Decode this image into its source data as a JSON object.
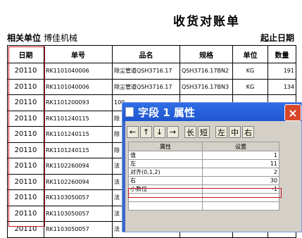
{
  "report": {
    "title": "收货对账单",
    "unit_label": "相关单位",
    "unit_value": "博佳机械",
    "date_label": "起止日期",
    "columns": [
      "日期",
      "单号",
      "品名",
      "规格",
      "单位",
      "数量"
    ],
    "rows": [
      {
        "date": "20110",
        "no": "RK1101040006",
        "name": "除尘管道QSH3716.17",
        "spec": "QSH3716.17BN2",
        "unit": "KG",
        "qty": "191"
      },
      {
        "date": "20110",
        "no": "RK1101040006",
        "name": "除尘管道QSH3716.17",
        "spec": "QSH3716.17BN3",
        "unit": "KG",
        "qty": "134"
      },
      {
        "date": "20110",
        "no": "RK1101200093",
        "name": "100",
        "spec": "",
        "unit": "",
        "qty": ""
      },
      {
        "date": "20110",
        "no": "RK1101240115",
        "name": "除",
        "spec": "",
        "unit": "",
        "qty": ""
      },
      {
        "date": "20110",
        "no": "RK1101240115",
        "name": "除",
        "spec": "",
        "unit": "",
        "qty": ""
      },
      {
        "date": "20110",
        "no": "RK1101240115",
        "name": "除",
        "spec": "",
        "unit": "",
        "qty": ""
      },
      {
        "date": "20110",
        "no": "RK1102260094",
        "name": "法",
        "spec": "",
        "unit": "",
        "qty": ""
      },
      {
        "date": "20110",
        "no": "RK1102260094",
        "name": "法",
        "spec": "",
        "unit": "",
        "qty": ""
      },
      {
        "date": "20110",
        "no": "RK1103050057",
        "name": "法",
        "spec": "",
        "unit": "",
        "qty": ""
      },
      {
        "date": "20110",
        "no": "RK1103050057",
        "name": "法",
        "spec": "",
        "unit": "",
        "qty": ""
      },
      {
        "date": "20110",
        "no": "RK1103050057",
        "name": "法",
        "spec": "",
        "unit": "",
        "qty": ""
      }
    ]
  },
  "dialog": {
    "title": "字段 1 属性",
    "close": "×",
    "toolbar": [
      "←",
      "↑",
      "↓",
      "→",
      "长",
      "短",
      "左",
      "中",
      "右"
    ],
    "prop_header": "属性",
    "value_header": "设置",
    "props": [
      {
        "name": "值",
        "value": "1"
      },
      {
        "name": "左",
        "value": "11"
      },
      {
        "name": "对齐(0,1,2)",
        "value": "2"
      },
      {
        "name": "右",
        "value": "30"
      },
      {
        "name": "小数位",
        "value": "-1"
      },
      {
        "name": "",
        "value": ""
      },
      {
        "name": "",
        "value": ""
      }
    ]
  },
  "colors": {
    "highlight": "#c8141e",
    "titlebar": "#1f55d0",
    "close": "#d9472b"
  }
}
